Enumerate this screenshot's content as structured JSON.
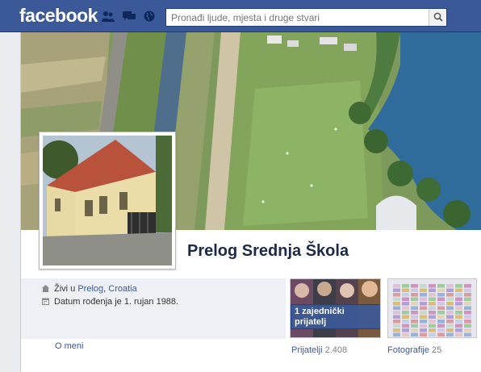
{
  "topbar": {
    "logo": "facebook",
    "search_placeholder": "Pronađi ljude, mjesta i druge stvari",
    "icons": [
      "friend-requests-icon",
      "messages-icon",
      "notifications-globe-icon",
      "search-icon"
    ]
  },
  "profile": {
    "name": "Prelog Srednja Škola",
    "lives_prefix": "Živi u ",
    "lives_city": "Prelog",
    "lives_sep": ", ",
    "lives_country": "Croatia",
    "birthday": "Datum rođenja je 1. rujan 1988.",
    "about_link": "O meni"
  },
  "friends": {
    "mutual_label": "1 zajednički prijatelj",
    "label": "Prijatelji",
    "count": "2.408"
  },
  "photos": {
    "label": "Fotografije",
    "count": "25"
  },
  "colors": {
    "brand": "#3b5998",
    "name_text": "#1c2a47",
    "info_bg": "#eef0f5"
  }
}
